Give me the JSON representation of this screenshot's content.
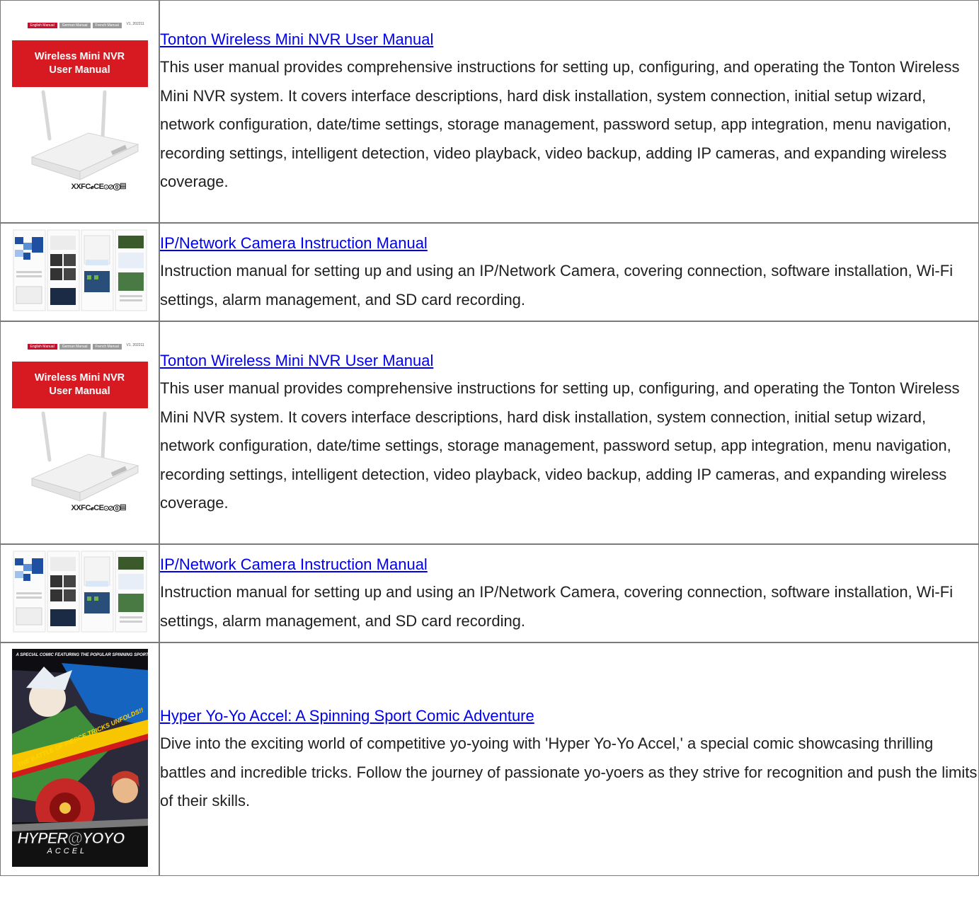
{
  "rows": [
    {
      "title": "Tonton Wireless Mini NVR User Manual",
      "description": "This user manual provides comprehensive instructions for setting up, configuring, and operating the Tonton Wireless Mini NVR system. It covers interface descriptions, hard disk installation, system connection, initial setup wizard, network configuration, date/time settings, storage management, password setup, app integration, menu navigation, recording settings, intelligent detection, video playback, video backup, adding IP cameras, and expanding wireless coverage.",
      "cover": {
        "tabs": [
          "English Manual",
          "German Manual",
          "French Manual"
        ],
        "version": "V1. 202211",
        "heading_line1": "Wireless Mini NVR",
        "heading_line2": "User Manual",
        "certs": "XXFC𝓮CE⊙⊘⓪▤"
      }
    },
    {
      "title": "IP/Network Camera Instruction Manual",
      "description": "Instruction manual for setting up and using an IP/Network Camera, covering connection, software installation, Wi-Fi settings, alarm management, and SD card recording."
    },
    {
      "title": "Tonton Wireless Mini NVR User Manual",
      "description": "This user manual provides comprehensive instructions for setting up, configuring, and operating the Tonton Wireless Mini NVR system. It covers interface descriptions, hard disk installation, system connection, initial setup wizard, network configuration, date/time settings, storage management, password setup, app integration, menu navigation, recording settings, intelligent detection, video playback, video backup, adding IP cameras, and expanding wireless coverage.",
      "cover": {
        "tabs": [
          "English Manual",
          "German Manual",
          "French Manual"
        ],
        "version": "V1. 202211",
        "heading_line1": "Wireless Mini NVR",
        "heading_line2": "User Manual",
        "certs": "XXFC𝓮CE⊙⊘⓪▤"
      }
    },
    {
      "title": "IP/Network Camera Instruction Manual",
      "description": "Instruction manual for setting up and using an IP/Network Camera, covering connection, software installation, Wi-Fi settings, alarm management, and SD card recording."
    },
    {
      "title": "Hyper Yo-Yo Accel: A Spinning Sport Comic Adventure",
      "description": "Dive into the exciting world of competitive yo-yoing with 'Hyper Yo-Yo Accel,' a special comic showcasing thrilling battles and incredible tricks. Follow the journey of passionate yo-yoers as they strive for recognition and push the limits of their skills.",
      "cover": {
        "top_line": "A SPECIAL COMIC FEATURING THE POPULAR SPINNING SPORT!",
        "tagline": "THE BATTLE OF FIERCE TRICKS UNFOLDS!!",
        "logo_main": "HYPER@YOYO",
        "logo_sub": "ACCEL"
      }
    }
  ],
  "colors": {
    "link": "#0000ee",
    "text": "#202020",
    "border": "#7a7a7a",
    "nvr_red": "#d71921",
    "tab_red": "#c8102e",
    "tab_gray": "#9a9a9a"
  }
}
